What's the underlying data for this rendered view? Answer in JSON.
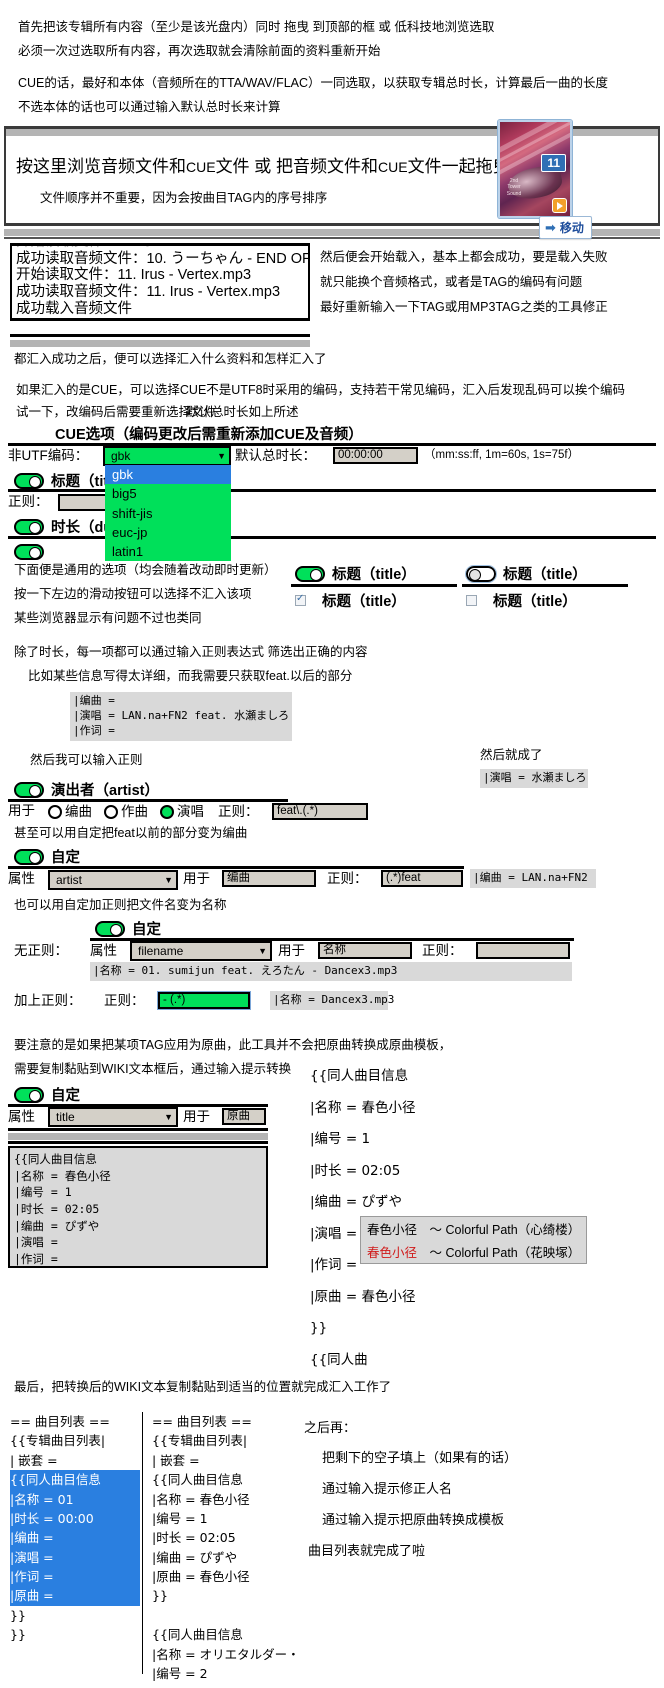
{
  "intro": {
    "line1": "首先把该专辑所有内容（至少是该光盘内）同时 拖曳 到顶部的框 或 低科技地浏览选取",
    "line2": "必须一次过选取所有内容，再次选取就会清除前面的资料重新开始",
    "line3": "CUE的话，最好和本体（音频所在的TTA/WAV/FLAC）一同选取，以获取专辑总时长，计算最后一曲的长度",
    "line4": "不选本体的话也可以通过输入默认总时长来计算"
  },
  "dropzone": {
    "prompt_a": "按这里浏览音频文件和",
    "prompt_cue1": "CUE",
    "prompt_b": "文件 或 把音频文件和",
    "prompt_cue2": "CUE",
    "prompt_c": "文件一起拖曳到这里",
    "hint": "文件顺序并不重要，因为会按曲目TAG内的序号排序",
    "thumb_badge": "11",
    "thumb_title": "2nd Tower Sound",
    "move_button": "移动",
    "move_arrow": "➡"
  },
  "log": {
    "lines": [
      "成功读取音频文件：10. うーちゃん - END OF",
      "开始读取文件：11. Irus - Vertex.mp3",
      "成功读取音频文件：11. Irus - Vertex.mp3",
      "成功载入音频文件"
    ],
    "notes": [
      "然后便会开始载入，基本上都会成功，要是载入失败",
      "就只能换个音频格式，或者是TAG的编码有问题",
      "最好重新输入一下TAG或用MP3TAG之类的工具修正"
    ]
  },
  "cue_intro": {
    "line1": "都汇入成功之后，便可以选择汇入什么资料和怎样汇入了",
    "line2": "如果汇入的是CUE，可以选择CUE不是UTF8时采用的编码，支持若干常见编码，汇入后发现乱码可以挨个编码",
    "line3": "试一下，改编码后需要重新选择文件",
    "line3b": "默认总时长如上所述"
  },
  "cue_panel": {
    "title": "CUE选项（编码更改后需重新添加CUE及音频）",
    "encoding_label": "非UTF编码：",
    "encoding_value": "gbk",
    "encoding_options": [
      "gbk",
      "big5",
      "shift-jis",
      "euc-jp",
      "latin1"
    ],
    "total_label": "默认总时长：",
    "total_value": "00:00:00",
    "total_hint": "（mm:ss:ff, 1m=60s, 1s=75f）",
    "row_title_label": "标题（title）",
    "regex_label": "正则：",
    "row_duration_label": "时长（duration）"
  },
  "general": {
    "note1": "下面便是通用的选项（均会随着改动即时更新）",
    "note2": "按一下左边的滑动按钮可以选择不汇入该项",
    "note3": "某些浏览器显示有问题不过也类同",
    "toggle_on_label": "标题（title）",
    "toggle_off_label": "标题（title）",
    "check_on_label": "标题（title）",
    "check_off_label": "标题（title）"
  },
  "regex_section": {
    "line1": "除了时长，每一项都可以通过输入正则表达式 筛选出正确的内容",
    "line2": "比如某些信息写得太详细，而我需要只获取feat.以后的部分",
    "preview1": "|编曲 =\n|演唱 = LAN.na+FN2 feat. 水瀬ましろ\n|作词 =",
    "line3": "然后我可以输入正则",
    "artist_label": "演出者（artist）",
    "use_label": "用于",
    "radio1": "编曲",
    "radio2": "作曲",
    "radio3": "演唱",
    "regex_label": "正则：",
    "regex_value": "feat\\.(.*)",
    "result_note": "然后就成了",
    "result_preview": "|演唱 = 水瀬ましろ",
    "line4": "甚至可以用自定把feat以前的部分变为编曲"
  },
  "custom1": {
    "toggle_label": "自定",
    "attr_label": "属性",
    "attr_value": "artist",
    "use_label": "用于",
    "use_value": "编曲",
    "regex_label": "正则：",
    "regex_value": "(.*)feat",
    "result_preview": "|编曲 = LAN.na+FN2"
  },
  "custom2": {
    "intro": "也可以用自定加正则把文件名变为名称",
    "toggle_label": "自定",
    "noregex_label": "无正则：",
    "attr_label": "属性",
    "attr_value": "filename",
    "use_label": "用于",
    "use_value": "名称",
    "regex_label": "正则：",
    "regex_value": "",
    "preview": "|名称 = 01. sumijun feat. えろたん - Dancex3.mp3",
    "withregex_label": "加上正则：",
    "withregex_regex_label": "正则：",
    "withregex_value": "- (.*)",
    "withregex_preview": "|名称 = Dancex3.mp3"
  },
  "wiki_section": {
    "note1": "要注意的是如果把某项TAG应用为原曲，此工具并不会把原曲转换成原曲模板，",
    "note2": "需要复制黏贴到WIKI文本框后，通过输入提示转换",
    "toggle_label": "自定",
    "attr_label": "属性",
    "attr_value": "title",
    "use_label": "用于",
    "use_value": "原曲",
    "textarea_content": "{{同人曲目信息\n|名称 = 春色小径\n|编号 = 1\n|时长 = 02:05\n|编曲 = ぴずや\n|演唱 =\n|作词 =\n|原曲 = 春色小径\n}}",
    "preview_lines": [
      "{{同人曲目信息",
      "|名称 = 春色小径",
      "|编号 = 1",
      "|时长 = 02:05",
      "|编曲 = ぴずや",
      "|演唱 =",
      "|作词 =",
      "|原曲 = 春色小径",
      "}}",
      "{{同人曲"
    ],
    "suggest1": "春色小径　～ Colorful Path（心绮楼）",
    "suggest2_hit": "春色小径",
    "suggest2_rest": "　～ Colorful Path（花映塚）"
  },
  "final": {
    "note": "最后，把转换后的WIKI文本复制黏贴到适当的位置就完成汇入工作了",
    "left_box": "== 曲目列表 ==\n{{专辑曲目列表|\n| 嵌套 =\n{{同人曲目信息\n|名称 = 01\n|时长 = 00:00\n|编曲 =\n|演唱 =\n|作词 =\n|原曲 =\n}}\n}}",
    "left_highlight_from": 3,
    "left_highlight_to": 9,
    "right_box": "== 曲目列表 ==\n{{专辑曲目列表|\n| 嵌套 =\n{{同人曲目信息\n|名称 = 春色小径\n|编号 = 1\n|时长 = 02:05\n|编曲 = ぴずや\n|原曲 = 春色小径\n}}\n\n{{同人曲目信息\n|名称 = オリエタルダー・\n|编号 = 2",
    "notes_title": "之后再：",
    "notes": [
      "把剩下的空子填上（如果有的话）",
      "通过输入提示修正人名",
      "通过输入提示把原曲转换成模板",
      "曲目列表就完成了啦"
    ]
  },
  "colors": {
    "accent_green": "#00e05a",
    "select_blue": "#2a7fe0",
    "gray_field": "#d4d0c8",
    "mono_bg": "#d9d9d9",
    "link_blue": "#1f4e9c",
    "red_hit": "#d01a1a"
  }
}
